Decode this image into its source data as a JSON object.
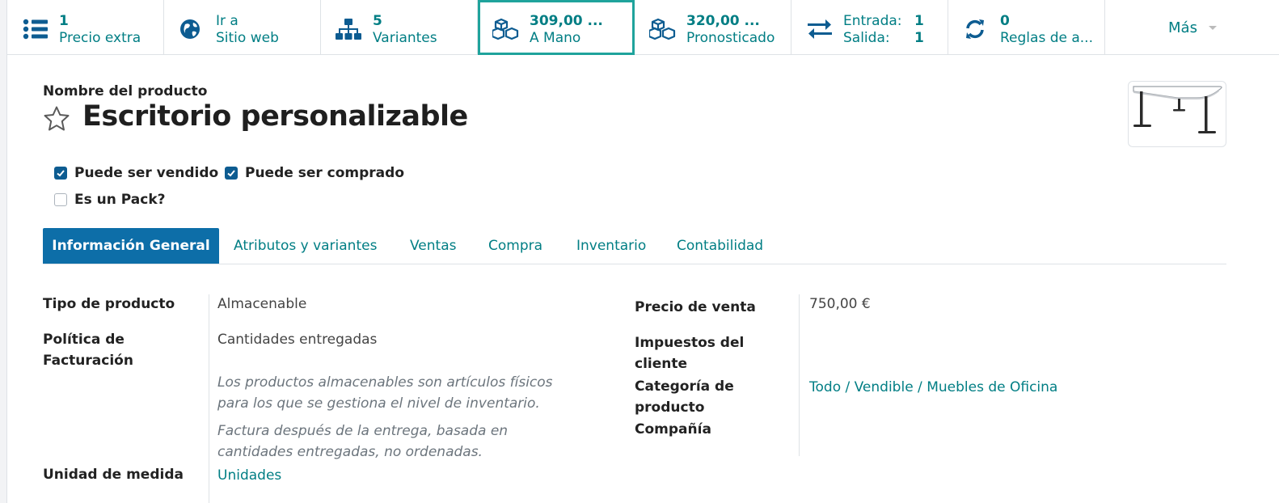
{
  "smart_buttons": [
    {
      "value": "1",
      "label": "Precio extra",
      "icon": "list-icon"
    },
    {
      "value": "Ir a",
      "label": "Sitio web",
      "icon": "globe-icon"
    },
    {
      "value": "5",
      "label": "Variantes",
      "icon": "sitemap-icon"
    },
    {
      "value": "309,00 ...",
      "label": "A Mano",
      "icon": "cubes-icon"
    },
    {
      "value": "320,00 ...",
      "label": "Pronosticado",
      "icon": "cubes-icon"
    },
    {
      "entrada_label": "Entrada:",
      "entrada_value": "1",
      "salida_label": "Salida:",
      "salida_value": "1",
      "icon": "exchange-icon"
    },
    {
      "value": "0",
      "label": "Reglas de a...",
      "icon": "refresh-icon"
    }
  ],
  "more_label": "Más",
  "product": {
    "name_label": "Nombre del producto",
    "name": "Escritorio personalizable"
  },
  "checkboxes": {
    "sale_ok": {
      "label": "Puede ser vendido",
      "checked": true
    },
    "purchase_ok": {
      "label": "Puede ser comprado",
      "checked": true
    },
    "is_pack": {
      "label": "Es un Pack?",
      "checked": false
    }
  },
  "tabs": [
    "Información General",
    "Atributos y variantes",
    "Ventas",
    "Compra",
    "Inventario",
    "Contabilidad"
  ],
  "form": {
    "left": {
      "product_type_label": "Tipo de producto",
      "product_type_value": "Almacenable",
      "invoice_policy_label_1": "Política de",
      "invoice_policy_label_2": "Facturación",
      "invoice_policy_value": "Cantidades entregadas",
      "help_1_line1": "Los productos almacenables son artículos físicos",
      "help_1_line2": "para los que se gestiona el nivel de inventario.",
      "help_2_line1": "Factura después de la entrega, basada en",
      "help_2_line2": "cantidades entregadas, no ordenadas.",
      "uom_label": "Unidad de medida",
      "uom_value": "Unidades"
    },
    "right": {
      "sale_price_label": "Precio de venta",
      "sale_price_value": "750,00 €",
      "taxes_label_1": "Impuestos del",
      "taxes_label_2": "cliente",
      "category_label_1": "Categoría de",
      "category_label_2": "producto",
      "category_value": "Todo / Vendible / Muebles de Oficina",
      "company_label": "Compañía"
    }
  },
  "colors": {
    "accent": "#017e84",
    "primary": "#0d6ea8",
    "highlight": "#1fa39c"
  }
}
